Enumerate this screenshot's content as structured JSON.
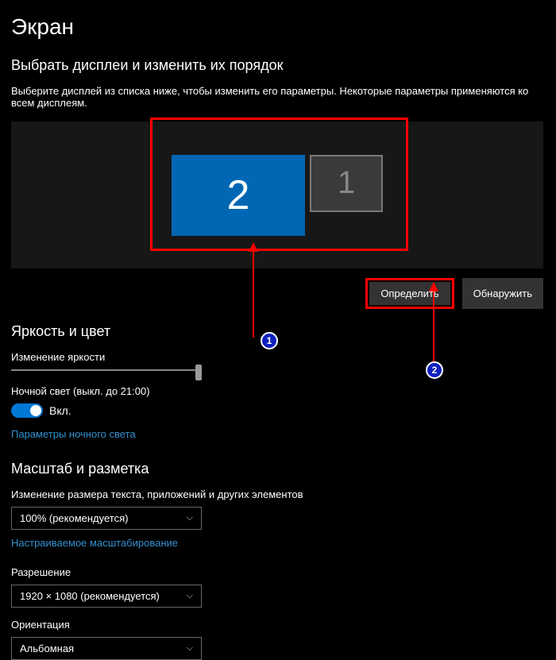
{
  "page": {
    "title": "Экран",
    "arrange_heading": "Выбрать дисплеи и изменить их порядок",
    "arrange_desc": "Выберите дисплей из списка ниже, чтобы изменить его параметры. Некоторые параметры применяются ко всем дисплеям."
  },
  "monitors": {
    "primary": "2",
    "secondary": "1"
  },
  "buttons": {
    "identify": "Определить",
    "detect": "Обнаружить"
  },
  "brightness": {
    "heading": "Яркость и цвет",
    "slider_label": "Изменение яркости",
    "night_light_label": "Ночной свет (выкл. до 21:00)",
    "toggle_state": "Вкл.",
    "night_light_settings": "Параметры ночного света"
  },
  "scale": {
    "heading": "Масштаб и разметка",
    "scale_label": "Изменение размера текста, приложений и других элементов",
    "scale_value": "100% (рекомендуется)",
    "custom_scaling": "Настраиваемое масштабирование",
    "resolution_label": "Разрешение",
    "resolution_value": "1920 × 1080 (рекомендуется)",
    "orientation_label": "Ориентация",
    "orientation_value": "Альбомная"
  },
  "annotations": {
    "marker1": "1",
    "marker2": "2"
  }
}
